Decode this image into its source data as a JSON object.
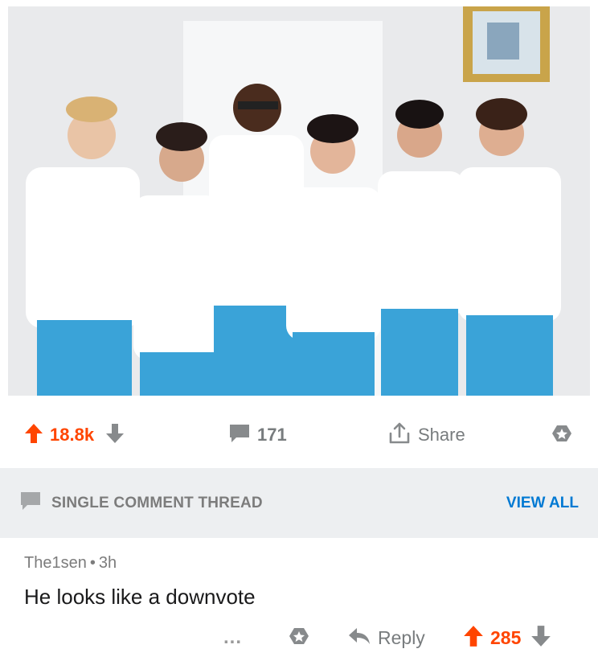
{
  "post": {
    "upvotes": "18.8k",
    "comments": "171",
    "share_label": "Share"
  },
  "thread": {
    "title": "SINGLE COMMENT THREAD",
    "view_all": "VIEW ALL"
  },
  "comment": {
    "author": "The1sen",
    "age": "3h",
    "text": "He looks like a downvote",
    "more": "...",
    "reply_label": "Reply",
    "score": "285"
  },
  "colors": {
    "upvote": "#ff4500",
    "link": "#0079d3",
    "muted": "#787c7e",
    "thread_bg": "#edeff1"
  },
  "icons": [
    "upvote-arrow-icon",
    "downvote-arrow-icon",
    "comment-bubble-icon",
    "share-icon",
    "award-icon",
    "reply-arrow-icon",
    "more-dots-icon"
  ]
}
